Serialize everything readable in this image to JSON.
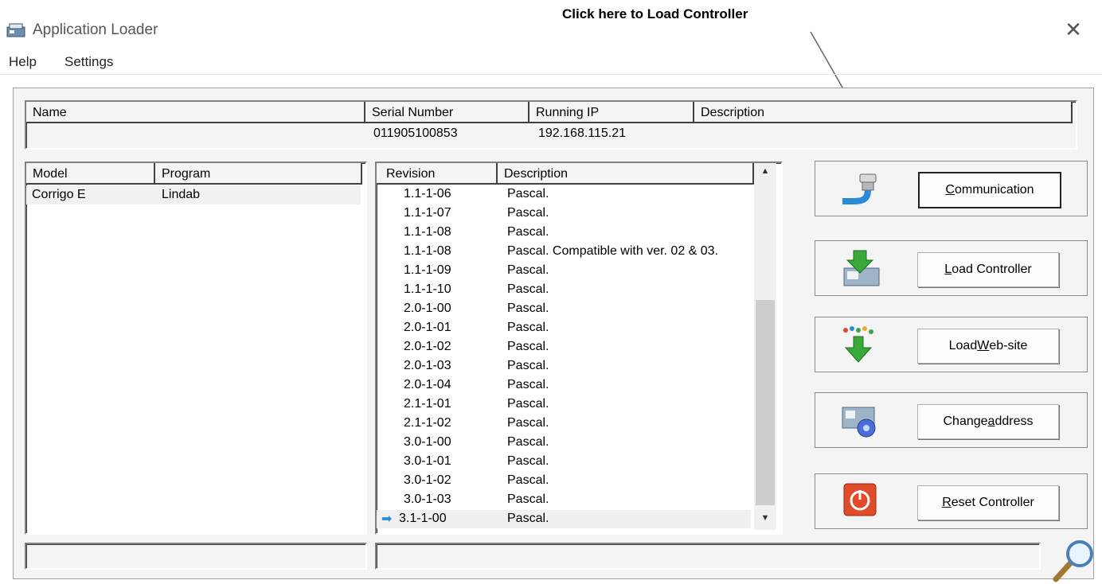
{
  "window": {
    "title": "Application Loader",
    "close_glyph": "✕"
  },
  "callout": {
    "text": "Click here to Load Controller"
  },
  "menu": {
    "items": [
      "Help",
      "Settings"
    ]
  },
  "device_table": {
    "headers": [
      "Name",
      "Serial Number",
      "Running IP",
      "Description"
    ],
    "row": {
      "name": "",
      "serial": "011905100853",
      "ip": "192.168.115.21",
      "description": ""
    }
  },
  "model_table": {
    "headers": [
      "Model",
      "Program"
    ],
    "rows": [
      {
        "model": "Corrigo E",
        "program": "Lindab"
      }
    ]
  },
  "revision_table": {
    "headers": [
      "Revision",
      "Description"
    ],
    "current_marker": "➡",
    "rows": [
      {
        "rev": "1.1-1-06",
        "desc": "Pascal."
      },
      {
        "rev": "1.1-1-07",
        "desc": "Pascal."
      },
      {
        "rev": "1.1-1-08",
        "desc": "Pascal."
      },
      {
        "rev": "1.1-1-08",
        "desc": "Pascal. Compatible with ver. 02 & 03."
      },
      {
        "rev": "1.1-1-09",
        "desc": "Pascal."
      },
      {
        "rev": "1.1-1-10",
        "desc": "Pascal."
      },
      {
        "rev": "2.0-1-00",
        "desc": "Pascal."
      },
      {
        "rev": "2.0-1-01",
        "desc": "Pascal."
      },
      {
        "rev": "2.0-1-02",
        "desc": "Pascal."
      },
      {
        "rev": "2.0-1-03",
        "desc": "Pascal."
      },
      {
        "rev": "2.0-1-04",
        "desc": "Pascal."
      },
      {
        "rev": "2.1-1-01",
        "desc": "Pascal."
      },
      {
        "rev": "2.1-1-02",
        "desc": "Pascal."
      },
      {
        "rev": "3.0-1-00",
        "desc": "Pascal."
      },
      {
        "rev": "3.0-1-01",
        "desc": "Pascal."
      },
      {
        "rev": "3.0-1-02",
        "desc": "Pascal."
      },
      {
        "rev": "3.0-1-03",
        "desc": "Pascal."
      },
      {
        "rev": "3.1-1-00",
        "desc": "Pascal.",
        "current": true
      }
    ],
    "scroll_up": "▲",
    "scroll_down": "▼"
  },
  "buttons": {
    "communication": {
      "pre": "",
      "ul": "C",
      "post": "ommunication"
    },
    "load_controller": {
      "pre": "",
      "ul": "L",
      "post": "oad Controller"
    },
    "load_website": {
      "pre": "Load ",
      "ul": "W",
      "post": "eb-site"
    },
    "change_address": {
      "pre": "Change ",
      "ul": "a",
      "post": "ddress"
    },
    "reset_controller": {
      "pre": "",
      "ul": "R",
      "post": "eset Controller"
    }
  },
  "icons": {
    "app": "application-loader-icon",
    "communication": "serial-connector-icon",
    "load_controller": "download-to-controller-icon",
    "load_website": "download-website-icon",
    "change_address": "controller-settings-icon",
    "reset_controller": "power-reset-icon",
    "search": "magnifier-icon"
  },
  "colors": {
    "accent_green": "#3aa83a",
    "reset_red": "#e04b2a",
    "arrow_blue": "#2a8ad8"
  }
}
